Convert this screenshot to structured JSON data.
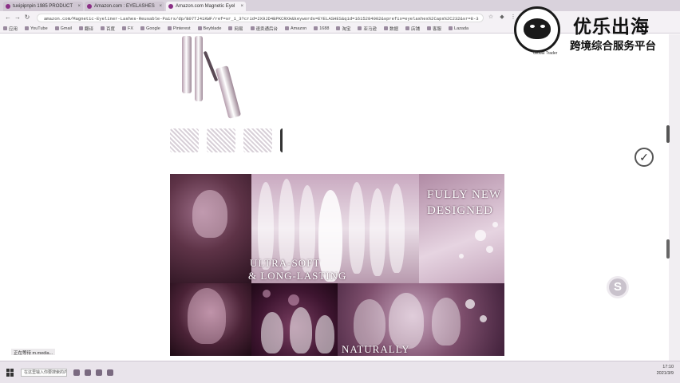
{
  "browser": {
    "tabs": [
      {
        "label": "tuxipipnpin 1985 PRODUCT",
        "active": false
      },
      {
        "label": "Amazon.com : EYELASHES",
        "active": false
      },
      {
        "label": "Amazon.com Magnetic Eyel",
        "active": true
      }
    ],
    "url": "amazon.com/Magnetic-Eyeliner-Lashes-Reusable-Pairs/dp/B07TJ41KWF/ref=sr_1_3?crid=2X9JD4BPKCRXH&keywords=EYELASHES&qid=1615284002&sprefix=eyelashes%2Caps%2C232&sr=8-3",
    "bookmarks": [
      "应用",
      "YouTube",
      "Gmail",
      "翻译",
      "百度",
      "FX",
      "Google",
      "Pinterest",
      "Beyblade",
      "网易",
      "速卖通后台",
      "Amazon",
      "1688",
      "淘宝",
      "亚马逊",
      "数据",
      "店铺",
      "客服",
      "Lazada",
      "速卖通",
      "平台"
    ]
  },
  "page": {
    "stripe_labels": [
      "",
      "",
      "",
      ""
    ],
    "banner": {
      "headline_line1": "FULLY NEW",
      "headline_line2": "DESIGNED",
      "ultra_line1": "ULTRA-SOFT",
      "ultra_line2": "& LONG-LASTING",
      "naturally": "NATURALLY"
    },
    "status_text": "正在等待 m.media..."
  },
  "floating": {
    "check_icon": "check-circle-icon",
    "s_icon": "S"
  },
  "watermark": {
    "title": "优乐出海",
    "subtitle": "跨境综合服务平台",
    "small": "Global Trader"
  },
  "taskbar": {
    "search_placeholder": "在这里输入你要搜索的内容",
    "time": "17:10",
    "date": "2021/3/9"
  }
}
